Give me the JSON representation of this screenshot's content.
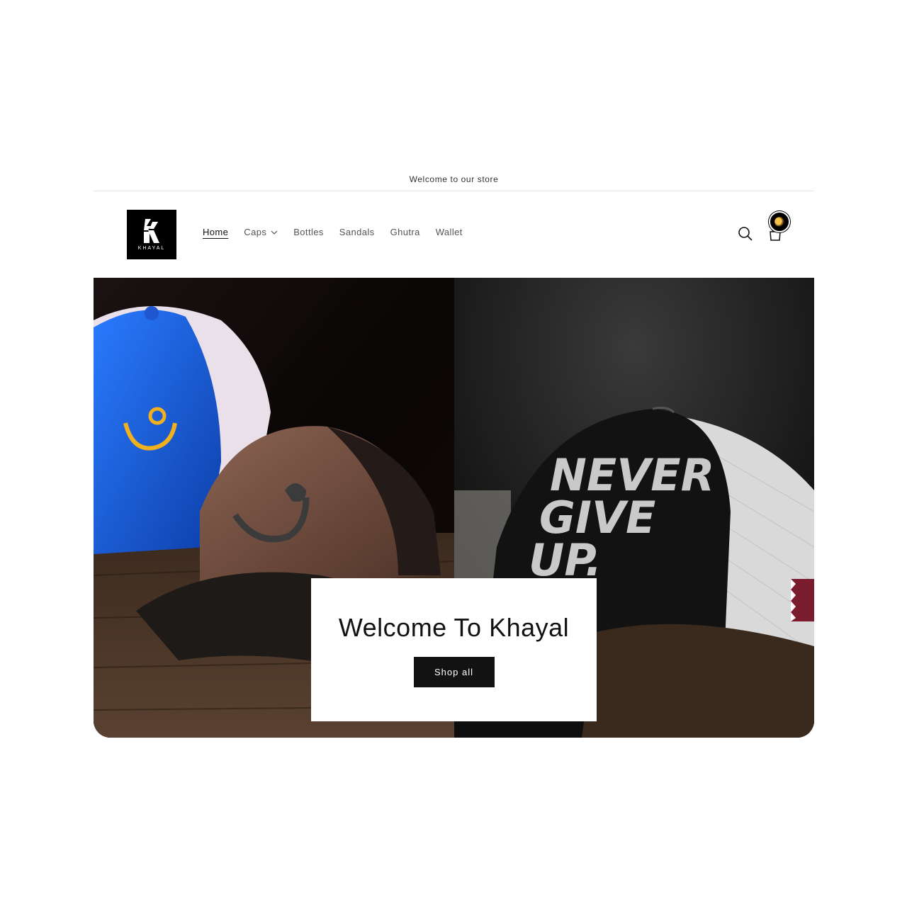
{
  "announcement": {
    "text": "Welcome to our store"
  },
  "brand": {
    "logo_text": "KHAYAL"
  },
  "nav": {
    "items": [
      {
        "label": "Home",
        "active": true,
        "has_dropdown": false
      },
      {
        "label": "Caps",
        "active": false,
        "has_dropdown": true
      },
      {
        "label": "Bottles",
        "active": false,
        "has_dropdown": false
      },
      {
        "label": "Sandals",
        "active": false,
        "has_dropdown": false
      },
      {
        "label": "Ghutra",
        "active": false,
        "has_dropdown": false
      },
      {
        "label": "Wallet",
        "active": false,
        "has_dropdown": false
      }
    ]
  },
  "header_icons": {
    "search": "search-icon",
    "cart": "cart-icon"
  },
  "hero": {
    "title": "Welcome To Khayal",
    "button_label": "Shop all",
    "right_image_text": [
      "NEVER",
      "GIVE",
      "UP."
    ]
  },
  "colors": {
    "text": "#121212",
    "button_bg": "#121212",
    "cap_blue": "#1a5fd6",
    "cap_brown": "#7a5443",
    "cap_yellow": "#f2b01e"
  }
}
